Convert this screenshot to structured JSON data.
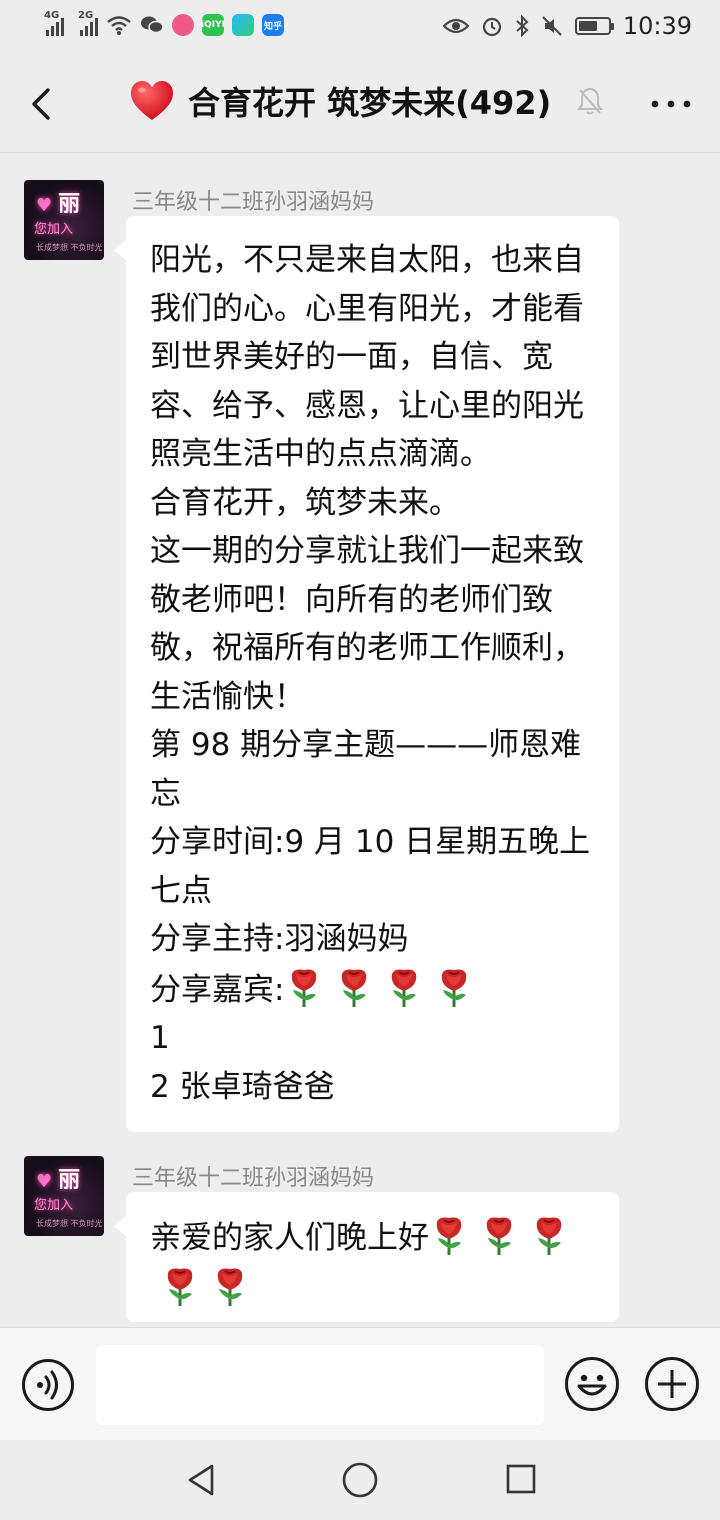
{
  "status_bar": {
    "time": "10:39",
    "network_1": "4G",
    "network_2": "2G",
    "app_icons": [
      "weibo-like-icon",
      "iqiyi-icon",
      "video-icon",
      "zhihu-icon"
    ],
    "app_icon_labels": [
      "",
      "iQIYI",
      "",
      "知乎"
    ],
    "battery_level": 0.6
  },
  "header": {
    "title": "合育花开 筑梦未来(492)",
    "title_icon": "red-heart-emoji",
    "muted": true
  },
  "messages": [
    {
      "sender": "三年级十二班孙羽涵妈妈",
      "avatar": {
        "text_top": "丽",
        "text_mid": "您加入",
        "text_small": "长成梦想 不负时光"
      },
      "lines": [
        "阳光，不只是来自太阳，也来自我们的心。心里有阳光，才能看到世界美好的一面，自信、宽容、给予、感恩，让心里的阳光照亮生活中的点点滴滴。",
        "合育花开，筑梦未来。",
        "这一期的分享就让我们一起来致敬老师吧！向所有的老师们致敬，祝福所有的老师工作顺利，生活愉快！",
        "第 98 期分享主题———师恩难忘",
        "分享时间:9 月 10 日星期五晚上七点",
        "分享主持:羽涵妈妈",
        "分享嘉宾:",
        "1",
        "2 张卓琦爸爸"
      ],
      "guest_roses": 4
    },
    {
      "sender": "三年级十二班孙羽涵妈妈",
      "avatar": {
        "text_top": "丽",
        "text_mid": "您加入",
        "text_small": "长成梦想 不负时光"
      },
      "text": "亲爱的家人们晚上好",
      "roses": 5
    }
  ],
  "input_bar": {
    "text_value": "",
    "left_icon": "voice-icon",
    "right_icons": [
      "emoji-icon",
      "plus-icon"
    ]
  },
  "colors": {
    "background": "#ededed",
    "bubble": "#ffffff",
    "sender_text": "#888888",
    "title_text": "#111111"
  }
}
